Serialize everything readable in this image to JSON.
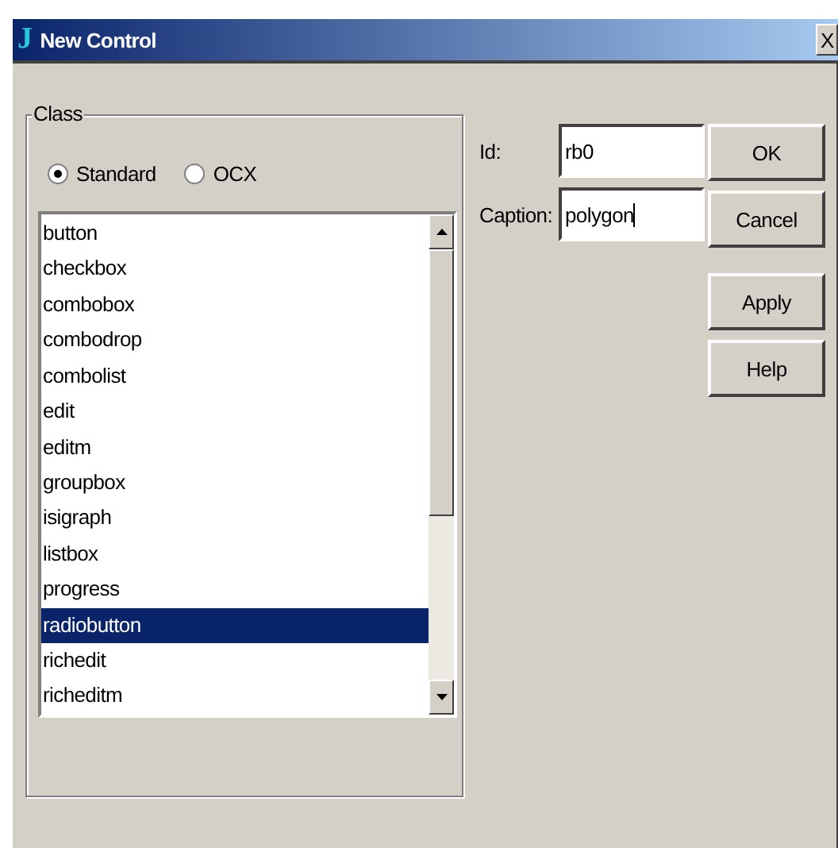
{
  "window": {
    "icon": "J",
    "title": "New Control",
    "close": "X"
  },
  "class_group": {
    "label": "Class",
    "radios": [
      {
        "label": "Standard",
        "selected": true
      },
      {
        "label": "OCX",
        "selected": false
      }
    ],
    "list": [
      {
        "label": "button",
        "selected": false
      },
      {
        "label": "checkbox",
        "selected": false
      },
      {
        "label": "combobox",
        "selected": false
      },
      {
        "label": "combodrop",
        "selected": false
      },
      {
        "label": "combolist",
        "selected": false
      },
      {
        "label": "edit",
        "selected": false
      },
      {
        "label": "editm",
        "selected": false
      },
      {
        "label": "groupbox",
        "selected": false
      },
      {
        "label": "isigraph",
        "selected": false
      },
      {
        "label": "listbox",
        "selected": false
      },
      {
        "label": "progress",
        "selected": false
      },
      {
        "label": "radiobutton",
        "selected": true
      },
      {
        "label": "richedit",
        "selected": false
      },
      {
        "label": "richeditm",
        "selected": false
      }
    ]
  },
  "fields": [
    {
      "label": "Id:",
      "value": "rb0",
      "focused": false
    },
    {
      "label": "Caption:",
      "value": "polygon",
      "focused": true
    }
  ],
  "buttons": [
    "OK",
    "Cancel",
    "Apply",
    "Help"
  ]
}
